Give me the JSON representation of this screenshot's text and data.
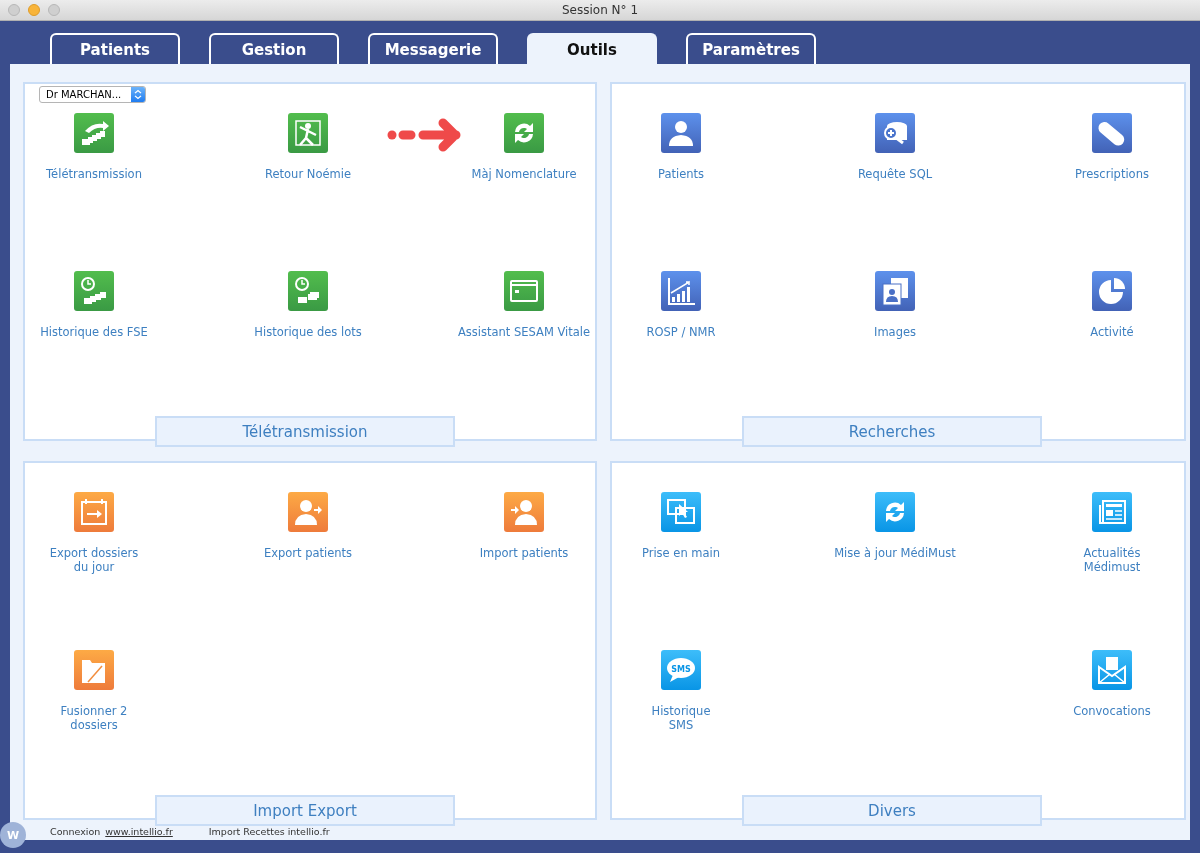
{
  "window": {
    "title": "Session N° 1"
  },
  "tabs": [
    {
      "label": "Patients",
      "selected": false
    },
    {
      "label": "Gestion",
      "selected": false
    },
    {
      "label": "Messagerie",
      "selected": false
    },
    {
      "label": "Outils",
      "selected": true
    },
    {
      "label": "Paramètres",
      "selected": false
    }
  ],
  "panels": [
    {
      "title": "Télétransmission",
      "dropdown": {
        "value": "Dr MARCHAN..."
      },
      "annotation": {
        "kind": "arrow"
      },
      "items": [
        {
          "kind": "tile",
          "label": "Télétransmission"
        },
        {
          "kind": "tile",
          "label": "Retour Noémie"
        },
        {
          "kind": "tile",
          "label": "Màj Nomenclature"
        },
        {
          "kind": "tile",
          "label": "Historique des FSE"
        },
        {
          "kind": "tile",
          "label": "Historique des lots"
        },
        {
          "kind": "tile",
          "label": "Assistant SESAM Vitale"
        }
      ]
    },
    {
      "title": "Recherches",
      "items": [
        {
          "kind": "tile",
          "label": "Patients"
        },
        {
          "kind": "tile",
          "label": "Requête SQL"
        },
        {
          "kind": "tile",
          "label": "Prescriptions"
        },
        {
          "kind": "tile",
          "label": "ROSP / NMR"
        },
        {
          "kind": "tile",
          "label": "Images"
        },
        {
          "kind": "tile",
          "label": "Activité"
        }
      ]
    },
    {
      "title": "Import Export",
      "items": [
        {
          "kind": "tile",
          "label": "Export dossiers\ndu jour"
        },
        {
          "kind": "tile",
          "label": "Export patients"
        },
        {
          "kind": "tile",
          "label": "Import patients"
        },
        {
          "kind": "tile",
          "label": "Fusionner 2\ndossiers"
        },
        {
          "kind": "empty"
        },
        {
          "kind": "empty"
        }
      ]
    },
    {
      "title": "Divers",
      "items": [
        {
          "kind": "tile",
          "label": "Prise en main"
        },
        {
          "kind": "tile",
          "label": "Mise à jour MédiMust"
        },
        {
          "kind": "tile",
          "label": "Actualités\nMédimust"
        },
        {
          "kind": "tile",
          "label": "Historique\nSMS",
          "icon_text": "SMS"
        },
        {
          "kind": "empty"
        },
        {
          "kind": "tile",
          "label": "Convocations"
        }
      ]
    }
  ],
  "footer": {
    "logo_letter": "W",
    "connexion_label": "Connexion",
    "connexion_link": "www.intellio.fr",
    "import_link": "Import Recettes intellio.fr"
  }
}
